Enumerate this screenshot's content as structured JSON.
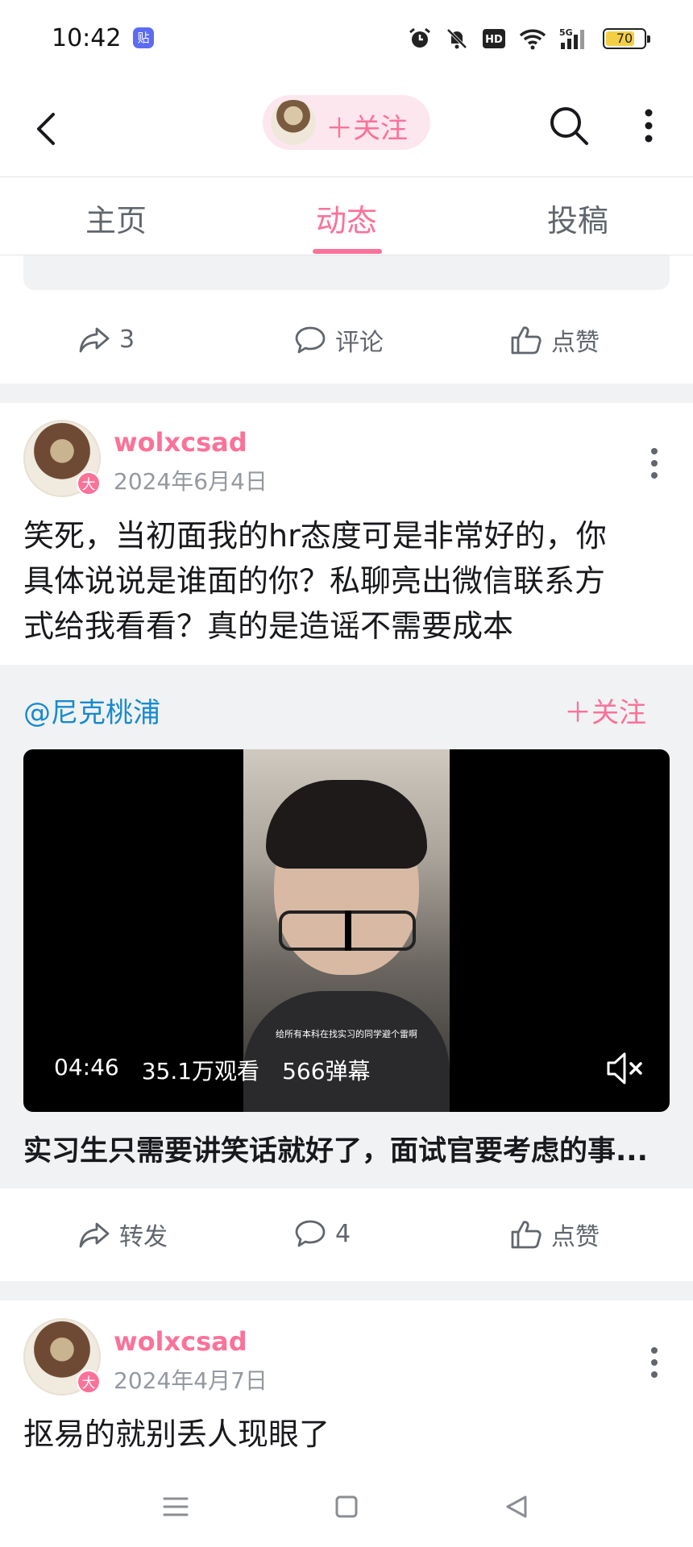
{
  "status_bar": {
    "time": "10:42",
    "app_icon_text": "贴",
    "battery": "70",
    "icons": [
      "alarm-icon",
      "mute-icon",
      "hd-icon",
      "wifi-icon",
      "5g-signal-icon",
      "battery-icon"
    ]
  },
  "header": {
    "follow_label": "＋关注",
    "accent_color": "#fb7299"
  },
  "tabs": [
    {
      "label": "主页",
      "active": false
    },
    {
      "label": "动态",
      "active": true
    },
    {
      "label": "投稿",
      "active": false
    }
  ],
  "prev_post_actions": {
    "share": "3",
    "comment": "评论",
    "like": "点赞"
  },
  "posts": [
    {
      "author": "wolxcsad",
      "badge": "大",
      "date": "2024年6月4日",
      "text_lines": [
        "笑死，当初面我的hr态度可是非常好的，你",
        "具体说说是谁面的你？私聊亮出微信联系方",
        "式给我看看？真的是造谣不需要成本"
      ],
      "forward": {
        "user": "@尼克桃浦",
        "follow": "＋关注",
        "video": {
          "duration": "04:46",
          "views": "35.1万观看",
          "danmaku": "566弹幕",
          "subtitle": "给所有本科在找实习的同学避个雷啊"
        },
        "title": "实习生只需要讲笑话就好了，面试官要考虑的事..."
      },
      "actions": {
        "share": "转发",
        "comment": "4",
        "like": "点赞"
      }
    },
    {
      "author": "wolxcsad",
      "badge": "大",
      "date": "2024年4月7日",
      "text_lines": [
        "抠易的就别丢人现眼了"
      ]
    }
  ]
}
